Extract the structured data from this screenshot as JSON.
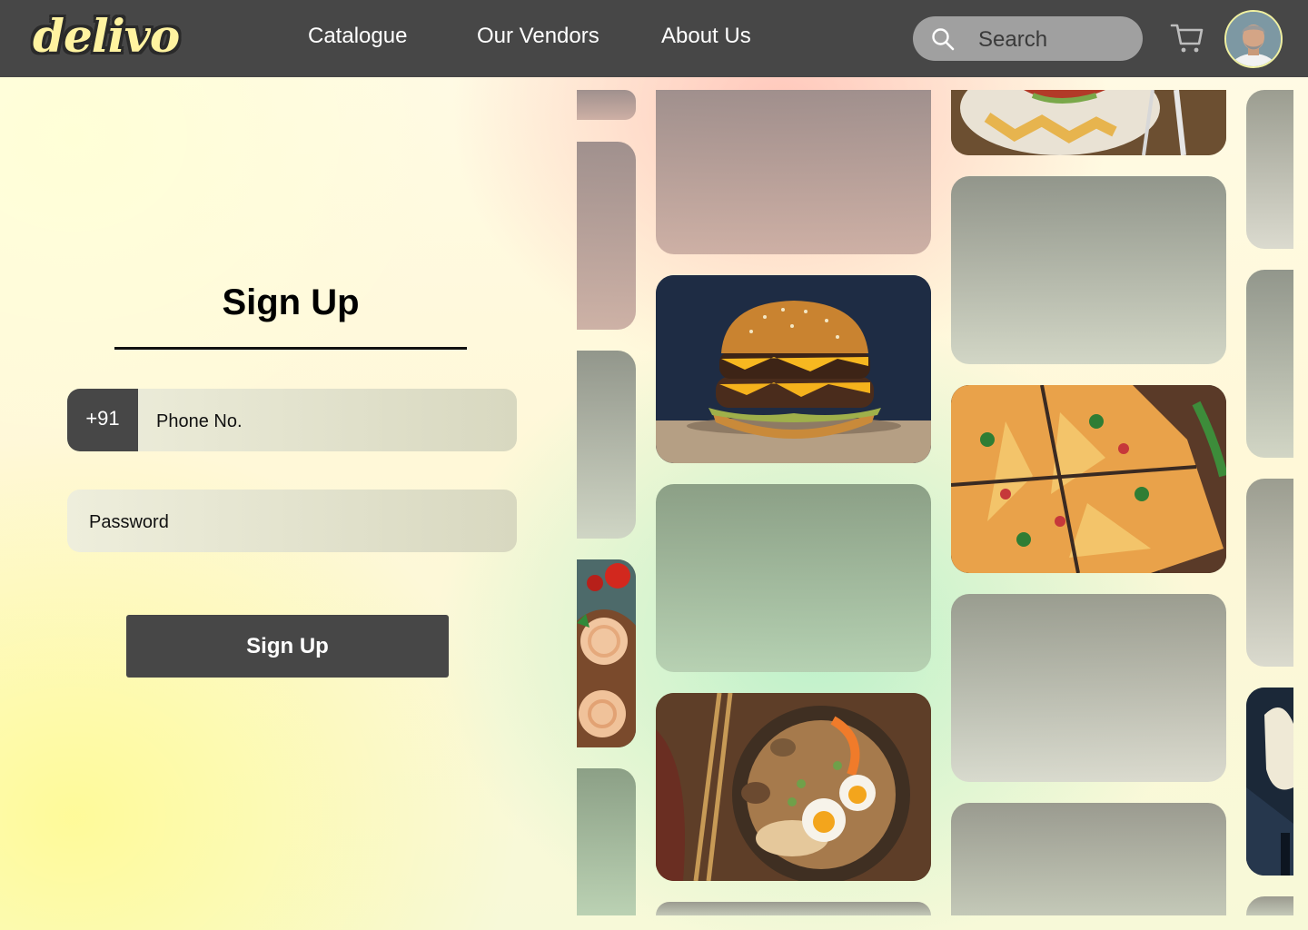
{
  "header": {
    "logo": "delivo",
    "nav": [
      {
        "label": "Catalogue"
      },
      {
        "label": "Our Vendors"
      },
      {
        "label": "About Us"
      }
    ],
    "search": {
      "placeholder": "Search"
    },
    "cart_icon": "shopping-cart-icon",
    "avatar_icon": "user-avatar"
  },
  "signup": {
    "title": "Sign Up",
    "phone": {
      "country_code": "+91",
      "placeholder": "Phone No."
    },
    "password": {
      "placeholder": "Password"
    },
    "submit_label": "Sign Up"
  },
  "colors": {
    "header_bg": "#474747",
    "logo_fill": "#fff3a0",
    "button_bg": "#474747"
  }
}
